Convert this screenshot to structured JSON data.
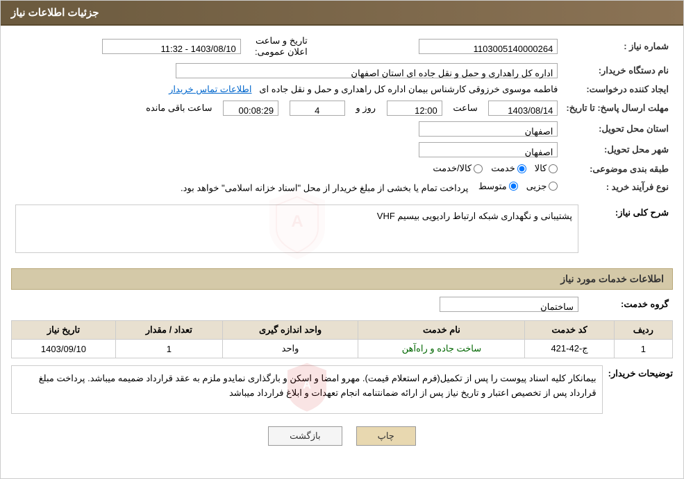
{
  "header": {
    "title": "جزئیات اطلاعات نیاز"
  },
  "fields": {
    "need_number_label": "شماره نیاز :",
    "need_number_value": "1103005140000264",
    "announce_date_label": "تاریخ و ساعت اعلان عمومی:",
    "announce_date_value": "1403/08/10 - 11:32",
    "buyer_org_label": "نام دستگاه خریدار:",
    "buyer_org_value": "اداره کل راهداری و حمل و نقل جاده ای استان اصفهان",
    "creator_label": "ایجاد کننده درخواست:",
    "creator_value": "فاطمه موسوی خرزوقی کارشناس بیمان اداره کل راهداری و حمل و نقل جاده ای",
    "creator_link": "اطلاعات تماس خریدار",
    "deadline_label": "مهلت ارسال پاسخ: تا تاریخ:",
    "deadline_date": "1403/08/14",
    "deadline_time_label": "ساعت",
    "deadline_time": "12:00",
    "deadline_day_label": "روز و",
    "deadline_days": "4",
    "deadline_remaining_label": "ساعت باقی مانده",
    "deadline_remaining": "00:08:29",
    "province_label": "استان محل تحویل:",
    "province_value": "اصفهان",
    "city_label": "شهر محل تحویل:",
    "city_value": "اصفهان",
    "category_label": "طبقه بندی موضوعی:",
    "category_options": [
      {
        "label": "کالا",
        "value": "kala"
      },
      {
        "label": "خدمت",
        "value": "khedmat"
      },
      {
        "label": "کالا/خدمت",
        "value": "kala_khedmat"
      }
    ],
    "category_selected": "khedmat",
    "purchase_type_label": "نوع فرآیند خرید :",
    "purchase_options": [
      {
        "label": "جزیی",
        "value": "jozi"
      },
      {
        "label": "متوسط",
        "value": "motavaset"
      }
    ],
    "purchase_selected": "motavaset",
    "purchase_note": "پرداخت تمام یا بخشی از مبلغ خریدار از محل \"اسناد خزانه اسلامی\" خواهد بود.",
    "description_label": "شرح کلی نیاز:",
    "description_value": "پشتیبانی و نگهداری شبکه ارتباط رادیویی بیسیم VHF",
    "services_section_label": "اطلاعات خدمات مورد نیاز",
    "service_group_label": "گروه خدمت:",
    "service_group_value": "ساختمان",
    "table": {
      "headers": [
        "ردیف",
        "کد خدمت",
        "نام خدمت",
        "واحد اندازه گیری",
        "تعداد / مقدار",
        "تاریخ نیاز"
      ],
      "rows": [
        {
          "row_num": "1",
          "service_code": "ج-42-421",
          "service_name": "ساخت جاده و راه‌آهن",
          "unit": "واحد",
          "quantity": "1",
          "date": "1403/09/10"
        }
      ]
    },
    "buyer_notes_label": "توضیحات خریدار:",
    "buyer_notes_value": "بیمانکار کلیه اسناد پیوست را پس از تکمیل(فرم استعلام قیمت). مهرو امضا و اسکن و بارگذاری نمایدو ملزم به عقد قرارداد ضمیمه میباشد. پرداخت مبلغ قرارداد پس از تخصیص اعتبار و تاریخ نیاز پس از ارائه ضمانتنامه انجام تعهدات و ابلاغ فرارداد میباشد",
    "buttons": {
      "back_label": "بازگشت",
      "print_label": "چاپ"
    }
  }
}
